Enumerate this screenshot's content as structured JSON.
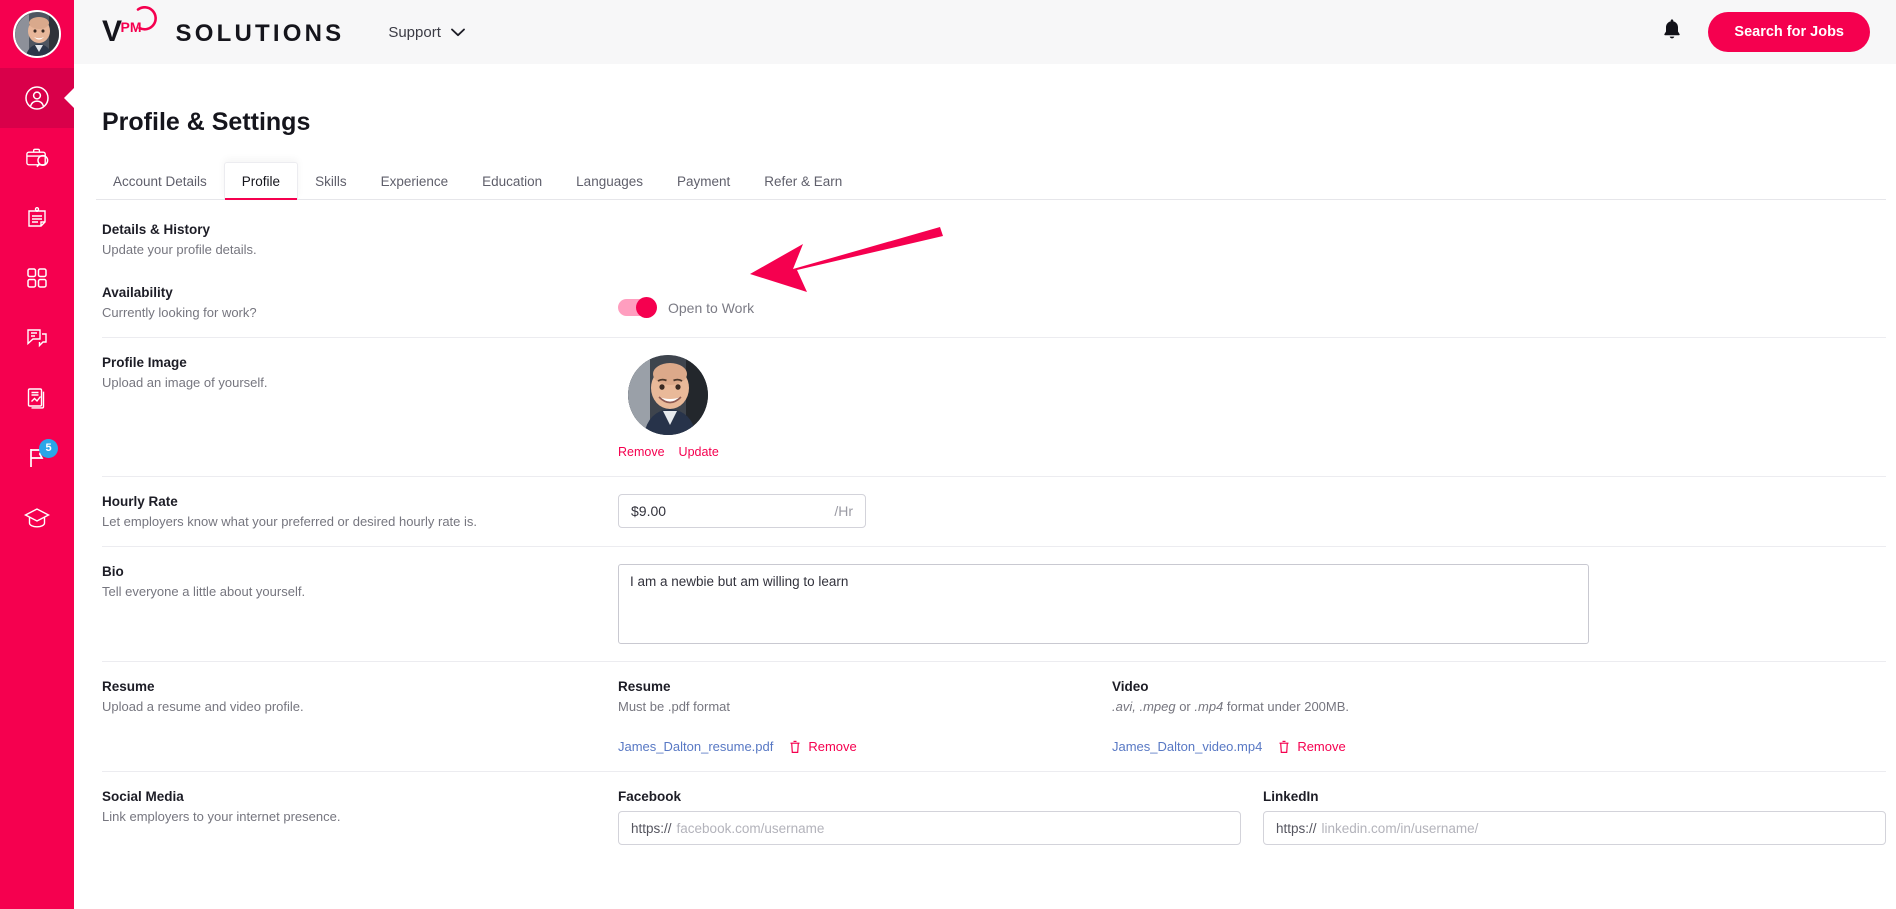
{
  "brand": {
    "v": "V",
    "pm": "PM",
    "word": "SOLUTIONS"
  },
  "header": {
    "support_label": "Support",
    "support_caret_icon": "chevron-down-icon",
    "bell_icon": "notification-bell-icon",
    "search_jobs_label": "Search for Jobs",
    "accent_color": "#F5004F"
  },
  "sidebar": {
    "background_color": "#F5004F",
    "avatar_icon": "user-avatar-photo",
    "items": [
      {
        "icon": "profile-user-icon",
        "active": true,
        "badge": null
      },
      {
        "icon": "job-search-briefcase-icon",
        "active": false,
        "badge": null
      },
      {
        "icon": "id-card-document-icon",
        "active": false,
        "badge": null
      },
      {
        "icon": "dashboard-grid-icon",
        "active": false,
        "badge": null
      },
      {
        "icon": "messages-chat-icon",
        "active": false,
        "badge": null
      },
      {
        "icon": "reports-chart-icon",
        "active": false,
        "badge": null
      },
      {
        "icon": "flag-icon",
        "active": false,
        "badge": "5"
      },
      {
        "icon": "graduation-cap-icon",
        "active": false,
        "badge": null
      }
    ],
    "badge_color": "#2BA6E8"
  },
  "page": {
    "title": "Profile & Settings"
  },
  "tabs": [
    {
      "label": "Account Details",
      "active": false
    },
    {
      "label": "Profile",
      "active": true
    },
    {
      "label": "Skills",
      "active": false
    },
    {
      "label": "Experience",
      "active": false
    },
    {
      "label": "Education",
      "active": false
    },
    {
      "label": "Languages",
      "active": false
    },
    {
      "label": "Payment",
      "active": false
    },
    {
      "label": "Refer & Earn",
      "active": false
    }
  ],
  "details": {
    "title": "Details & History",
    "subtitle": "Update your profile details."
  },
  "availability": {
    "title": "Availability",
    "subtitle": "Currently looking for work?",
    "toggle_label": "Open to Work",
    "toggle_on": true
  },
  "profile_image": {
    "title": "Profile Image",
    "subtitle": "Upload an image of yourself.",
    "remove_label": "Remove",
    "update_label": "Update"
  },
  "hourly_rate": {
    "title": "Hourly Rate",
    "subtitle": "Let employers know what your preferred or desired hourly rate is.",
    "value": "$9.00",
    "suffix": "/Hr"
  },
  "bio": {
    "title": "Bio",
    "subtitle": "Tell everyone a little about yourself.",
    "value": "I am a newbie but am willing to learn"
  },
  "resume": {
    "title": "Resume",
    "subtitle": "Upload a resume and video profile.",
    "resume_col": {
      "title": "Resume",
      "subtitle": "Must be .pdf format",
      "file_name": "James_Dalton_resume.pdf",
      "remove_label": "Remove",
      "remove_icon": "trash-icon"
    },
    "video_col": {
      "title": "Video",
      "subtitle_em1": ".avi, .mpeg",
      "subtitle_mid": " or ",
      "subtitle_em2": ".mp4",
      "subtitle_tail": " format under 200MB.",
      "file_name": "James_Dalton_video.mp4",
      "remove_label": "Remove",
      "remove_icon": "trash-icon"
    }
  },
  "social_media": {
    "title": "Social Media",
    "subtitle": "Link employers to your internet presence.",
    "facebook": {
      "label": "Facebook",
      "prefix": "https://",
      "placeholder": "facebook.com/username",
      "value": ""
    },
    "linkedin": {
      "label": "LinkedIn",
      "prefix": "https://",
      "placeholder": "linkedin.com/in/username/",
      "value": ""
    }
  },
  "annotation": {
    "arrow_color": "#F5004F",
    "points_to": "availability-toggle"
  }
}
